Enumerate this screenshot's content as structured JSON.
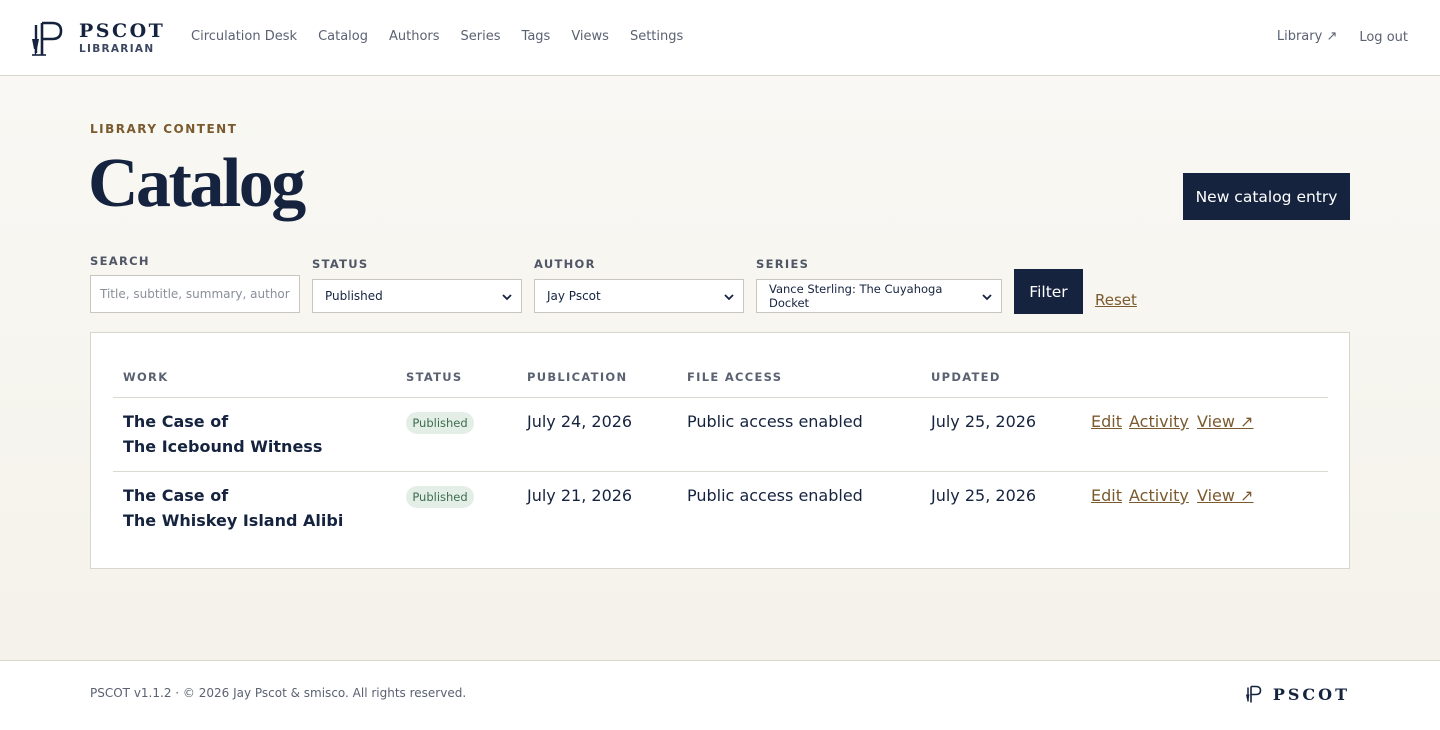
{
  "brand": {
    "name": "PSCOT",
    "subtitle": "LIBRARIAN",
    "logo_icon": "pen-nib-logo-icon"
  },
  "nav": {
    "items": [
      {
        "label": "Circulation Desk"
      },
      {
        "label": "Catalog"
      },
      {
        "label": "Authors"
      },
      {
        "label": "Series"
      },
      {
        "label": "Tags"
      },
      {
        "label": "Views"
      },
      {
        "label": "Settings"
      }
    ],
    "library_link": "Library ↗",
    "logout": "Log out"
  },
  "header": {
    "eyebrow": "LIBRARY CONTENT",
    "title": "Catalog",
    "new_entry_button": "New catalog entry"
  },
  "filters": {
    "search": {
      "label": "SEARCH",
      "placeholder": "Title, subtitle, summary, author,",
      "value": ""
    },
    "status": {
      "label": "STATUS",
      "selected": "Published"
    },
    "author": {
      "label": "AUTHOR",
      "selected": "Jay Pscot"
    },
    "series": {
      "label": "SERIES",
      "selected": "Vance Sterling: The Cuyahoga Docket"
    },
    "filter_button": "Filter",
    "reset_link": "Reset"
  },
  "table": {
    "columns": {
      "work": "WORK",
      "status": "STATUS",
      "publication": "PUBLICATION",
      "file_access": "FILE ACCESS",
      "updated": "UPDATED"
    },
    "rows": [
      {
        "title_line1": "The Case of",
        "title_line2": "The Icebound Witness",
        "status": "Published",
        "publication": "July 24, 2026",
        "file_access": "Public access enabled",
        "updated": "July 25, 2026",
        "actions": {
          "edit": "Edit",
          "activity": "Activity",
          "view": "View ↗"
        }
      },
      {
        "title_line1": "The Case of",
        "title_line2": "The Whiskey Island Alibi",
        "status": "Published",
        "publication": "July 21, 2026",
        "file_access": "Public access enabled",
        "updated": "July 25, 2026",
        "actions": {
          "edit": "Edit",
          "activity": "Activity",
          "view": "View ↗"
        }
      }
    ]
  },
  "footer": {
    "copyright": "PSCOT v1.1.2 · © 2026 Jay Pscot & smisco. All rights reserved.",
    "brand": "PSCOT"
  },
  "colors": {
    "navy": "#15233f",
    "accent_brown": "#7a5a2e",
    "badge_green_bg": "#e3efe6",
    "badge_green_text": "#3f6d50",
    "page_bg": "#f5f3ec"
  }
}
